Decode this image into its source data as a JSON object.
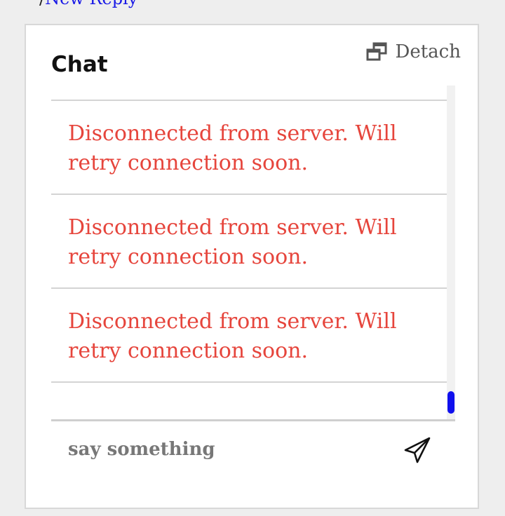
{
  "breadcrumb": {
    "separator": "/",
    "link_label": "New Reply"
  },
  "chat": {
    "title": "Chat",
    "detach_label": "Detach",
    "messages": [
      "Disconnected from server. Will retry connection soon.",
      "Disconnected from server. Will retry connection soon.",
      "Disconnected from server. Will retry connection soon.",
      "Disconnected from server. Will retry connection soon."
    ],
    "input_placeholder": "say something",
    "scroll_position_fraction": 1.0,
    "error_color": "#e6453c",
    "scrollbar_thumb_color": "#1010ee"
  },
  "icons": {
    "detach": "detach-icon",
    "send": "paper-plane-icon"
  }
}
